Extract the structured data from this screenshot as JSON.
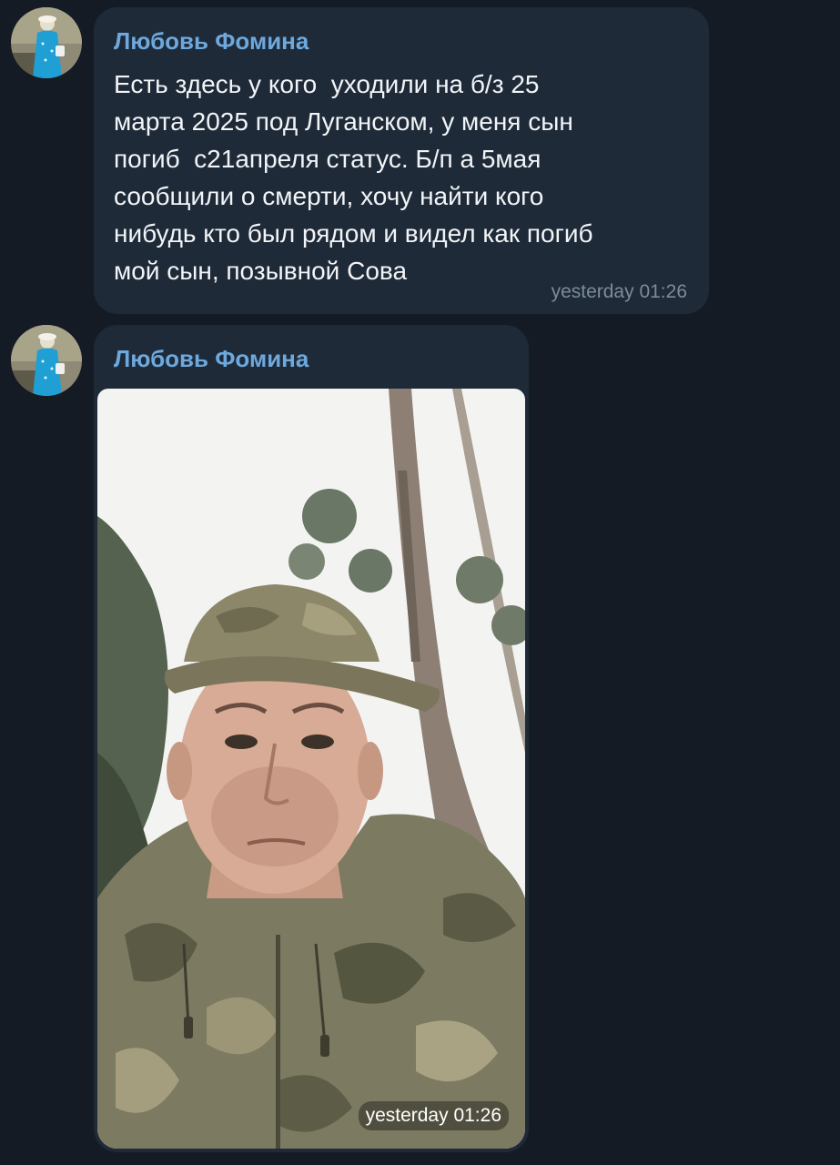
{
  "messages": [
    {
      "sender": "Любовь Фомина",
      "text": "Есть здесь у кого  уходили на б/з 25\nмарта 2025 под Луганском, у меня сын\nпогиб  с21апреля статус. Б/п а 5мая\nсообщили о смерти, хочу найти кого\nнибудь кто был рядом и видел как погиб\nмой сын, позывной Сова",
      "time": "yesterday 01:26"
    },
    {
      "sender": "Любовь Фомина",
      "time": "yesterday 01:26"
    }
  ],
  "colors": {
    "background": "#151b24",
    "bubble": "#1e2a38",
    "sender_name": "#6ea8dc",
    "message_text": "#f2f4f7",
    "timestamp": "#7c8b9b"
  }
}
